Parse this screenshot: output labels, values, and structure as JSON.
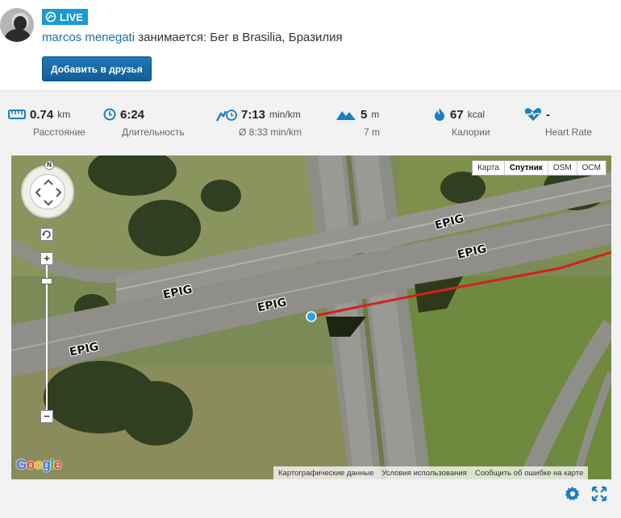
{
  "header": {
    "live_label": "LIVE",
    "user_name": "marcos menegati",
    "activity_text": " занимается: Бег в Brasilia, Бразилия",
    "add_friend_label": "Добавить в друзья"
  },
  "stats": [
    {
      "icon": "ruler-icon",
      "value": "0.74",
      "unit": "km",
      "label": "Расстояние"
    },
    {
      "icon": "clock-icon",
      "value": "6:24",
      "unit": "",
      "label": "Длительность"
    },
    {
      "icon": "pace-icon",
      "value": "7:13",
      "unit": "min/km",
      "label": "Ø 8:33 min/km"
    },
    {
      "icon": "mountain-icon",
      "value": "5",
      "unit": "m",
      "label": "7 m"
    },
    {
      "icon": "flame-icon",
      "value": "67",
      "unit": "kcal",
      "label": "Калории"
    },
    {
      "icon": "heart-rate-icon",
      "value": "-",
      "unit": "",
      "label": "Heart Rate"
    }
  ],
  "map": {
    "types": [
      "Карта",
      "Спутник",
      "OSM",
      "OCM"
    ],
    "active_type": "Спутник",
    "compass_label": "N",
    "zoom_in": "+",
    "zoom_out": "−",
    "road_labels": [
      "EPIG",
      "EPIG",
      "EPIG",
      "EPIG",
      "EPIG"
    ],
    "attribution": [
      "Картографические данные",
      "Условия использования",
      "Сообщить об ошибке на карте"
    ],
    "watermark": "Google",
    "track_color": "#d42020",
    "position_color": "#2aa6e8"
  }
}
